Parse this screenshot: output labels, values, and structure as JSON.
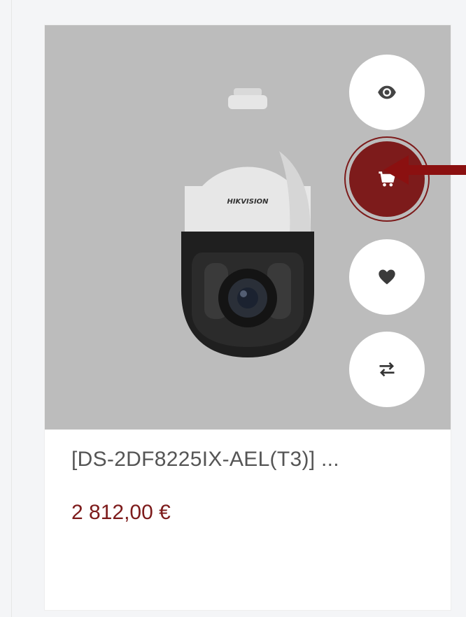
{
  "product": {
    "title": "[DS-2DF8225IX-AEL(T3)] ...",
    "price": "2 812,00 €",
    "brand_text": "HIKVISION"
  },
  "actions": [
    {
      "name": "quick-view",
      "icon": "eye-icon"
    },
    {
      "name": "add-to-cart",
      "icon": "cart-icon",
      "highlighted": true
    },
    {
      "name": "wishlist",
      "icon": "heart-icon"
    },
    {
      "name": "compare",
      "icon": "compare-icon"
    }
  ],
  "colors": {
    "accent": "#7d1b1b",
    "image_bg": "#bcbcbc",
    "page_bg": "#f4f5f7",
    "text_muted": "#555555"
  }
}
